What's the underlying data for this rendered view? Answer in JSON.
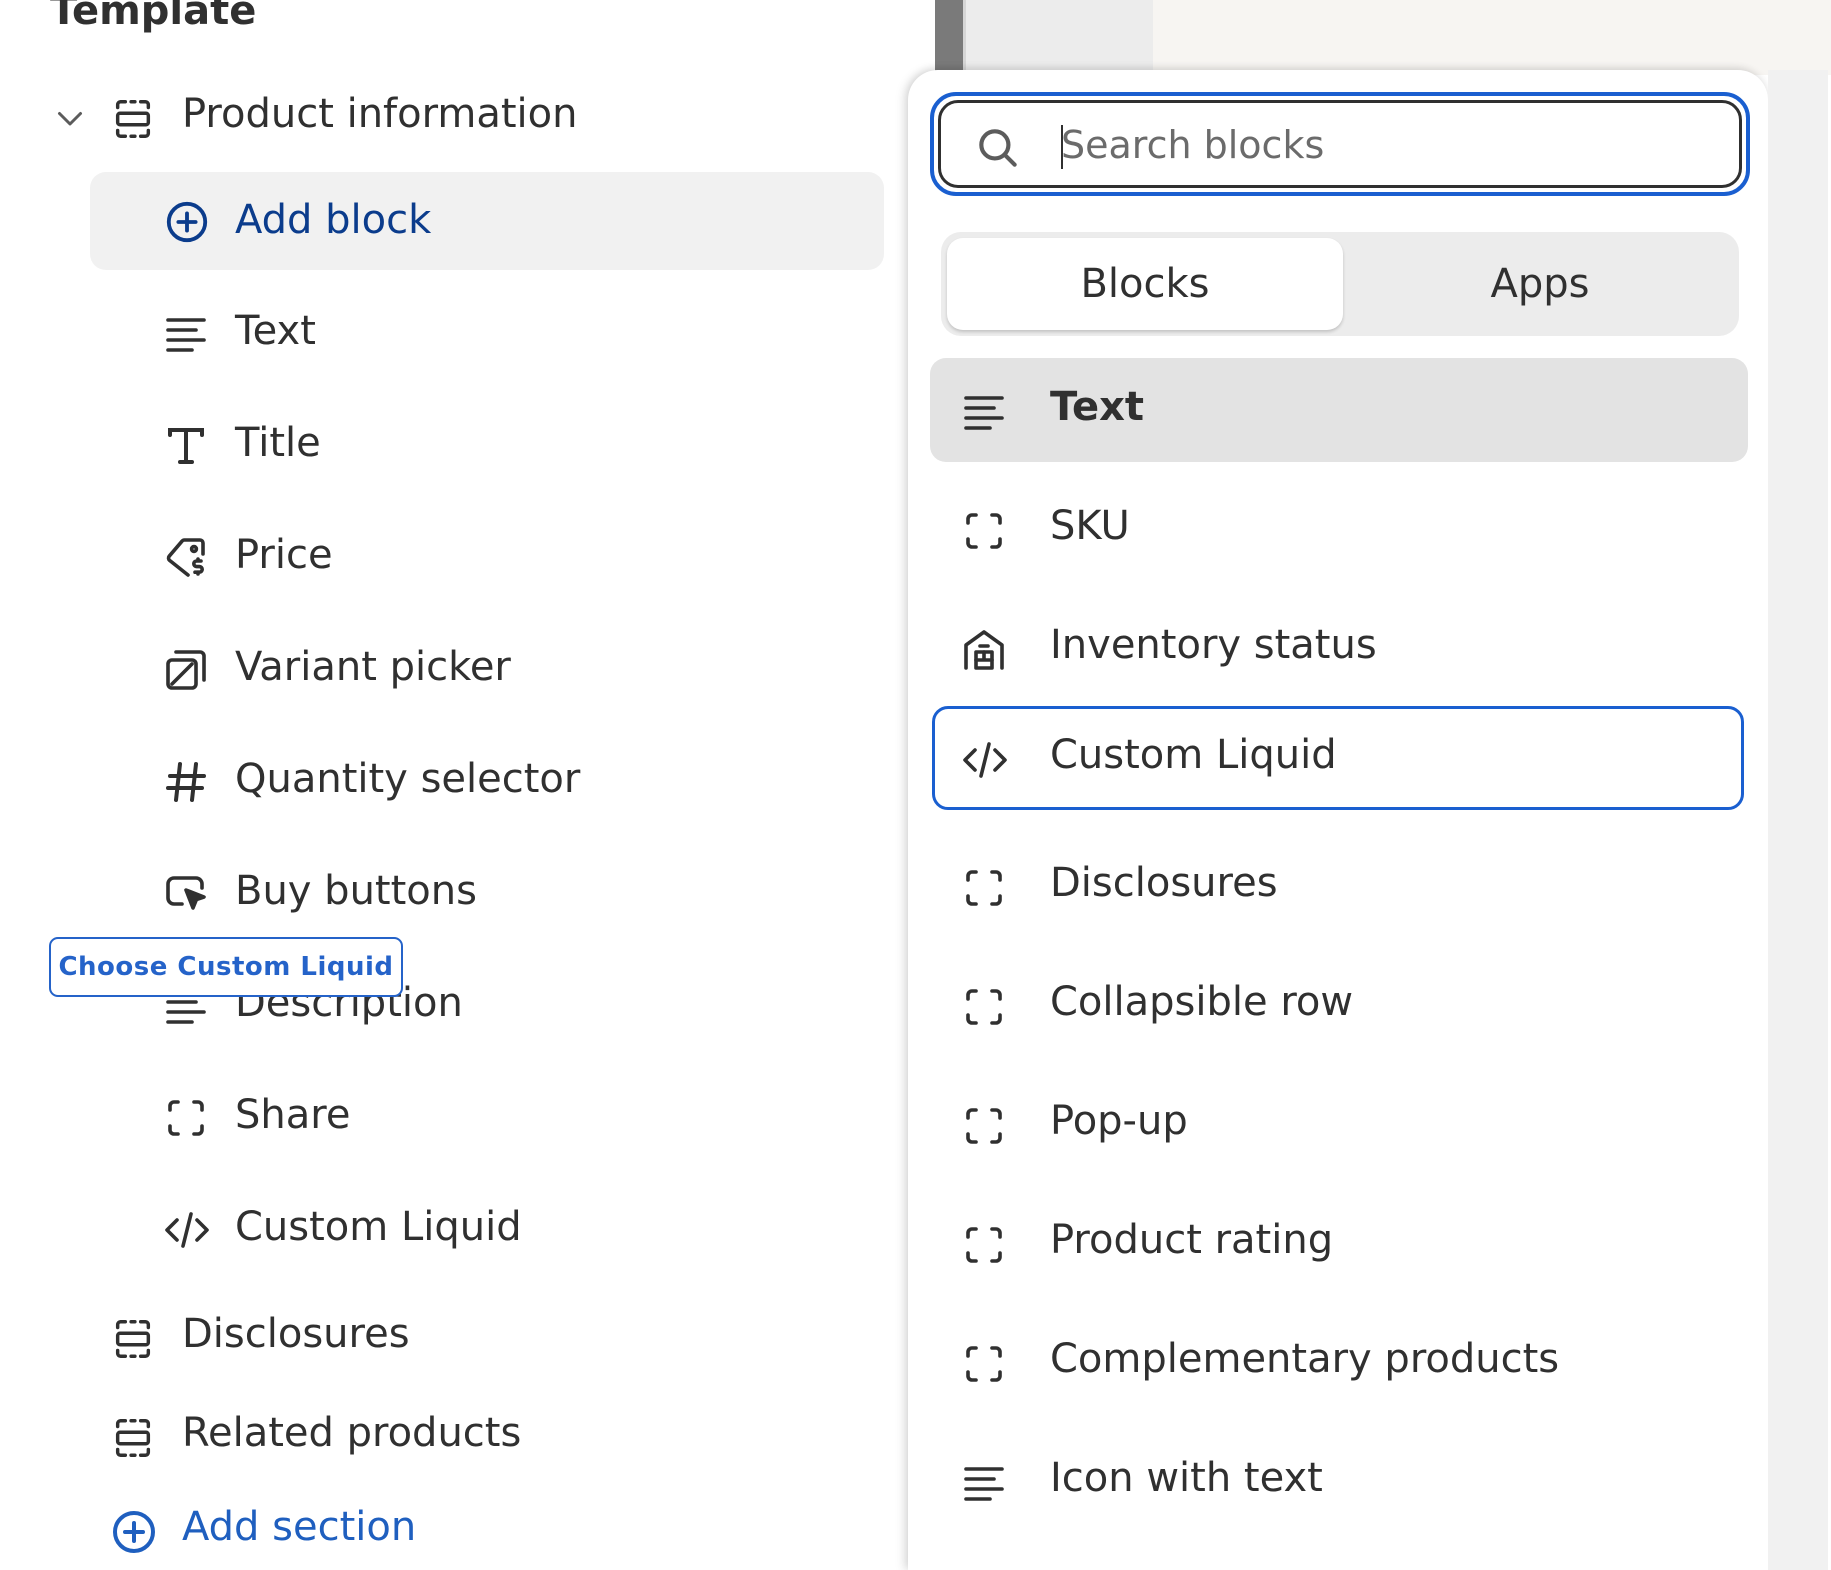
{
  "left_panel": {
    "heading": "Template",
    "sections": {
      "product_information": "Product information",
      "disclosures": "Disclosures",
      "related_products": "Related products"
    },
    "add_block_label": "Add block",
    "blocks": [
      {
        "label": "Text",
        "icon": "text-lines-icon"
      },
      {
        "label": "Title",
        "icon": "title-t-icon"
      },
      {
        "label": "Price",
        "icon": "price-tag-icon"
      },
      {
        "label": "Variant picker",
        "icon": "variant-picker-icon"
      },
      {
        "label": "Quantity selector",
        "icon": "hash-icon"
      },
      {
        "label": "Buy buttons",
        "icon": "cursor-click-icon"
      },
      {
        "label": "Description",
        "icon": "text-lines-icon"
      },
      {
        "label": "Share",
        "icon": "dashed-square-icon"
      },
      {
        "label": "Custom Liquid",
        "icon": "code-icon"
      }
    ],
    "add_section_label": "Add section"
  },
  "tooltip": "Choose Custom Liquid",
  "popover": {
    "search_placeholder": "Search blocks",
    "tabs": {
      "blocks": "Blocks",
      "apps": "Apps"
    },
    "items": [
      {
        "label": "Text",
        "icon": "text-lines-icon",
        "state": "hover"
      },
      {
        "label": "SKU",
        "icon": "dashed-square-icon"
      },
      {
        "label": "Inventory status",
        "icon": "warehouse-icon"
      },
      {
        "label": "Custom Liquid",
        "icon": "code-icon",
        "state": "focused"
      },
      {
        "label": "Disclosures",
        "icon": "dashed-square-icon"
      },
      {
        "label": "Collapsible row",
        "icon": "dashed-square-icon"
      },
      {
        "label": "Pop-up",
        "icon": "dashed-square-icon"
      },
      {
        "label": "Product rating",
        "icon": "dashed-square-icon"
      },
      {
        "label": "Complementary products",
        "icon": "dashed-square-icon"
      },
      {
        "label": "Icon with text",
        "icon": "text-lines-icon"
      }
    ]
  },
  "colors": {
    "accent_blue": "#1a5fd0",
    "link_blue": "#1f5fbf",
    "add_block_text": "#0b3c8c",
    "text": "#303030",
    "hover_bg": "#e3e3e3",
    "selected_bg": "#f1f1f1"
  }
}
